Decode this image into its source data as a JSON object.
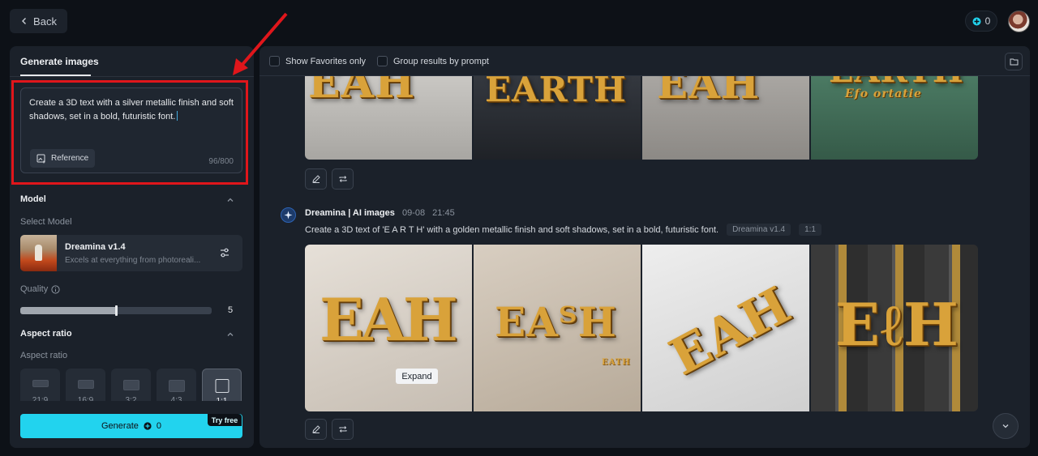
{
  "nav": {
    "back_label": "Back"
  },
  "account": {
    "credits": "0"
  },
  "sidebar": {
    "tab_label": "Generate images",
    "prompt": {
      "text": "Create a 3D text with a silver metallic finish and soft shadows, set in a bold, futuristic font.",
      "reference_label": "Reference",
      "char_count": "96/800"
    },
    "model_section": {
      "title": "Model",
      "select_label": "Select Model",
      "model_name": "Dreamina v1.4",
      "model_desc": "Excels at everything from photoreali..."
    },
    "quality": {
      "label": "Quality",
      "value": "5",
      "level_fraction": 0.5
    },
    "aspect_section": {
      "title": "Aspect ratio",
      "sub_label": "Aspect ratio",
      "options": [
        {
          "label": "21:9",
          "selected": false
        },
        {
          "label": "16:9",
          "selected": false
        },
        {
          "label": "3:2",
          "selected": false
        },
        {
          "label": "4:3",
          "selected": false
        },
        {
          "label": "1:1",
          "selected": true
        }
      ]
    },
    "generate": {
      "label": "Generate",
      "cost": "0",
      "badge": "Try free"
    }
  },
  "results": {
    "filters": {
      "favorites_label": "Show Favorites only",
      "group_label": "Group results by prompt"
    },
    "top_group": {
      "images": [
        {
          "text": "EAH",
          "bg": "#b8b6b2"
        },
        {
          "text": "EARTH",
          "bg": "#2a2d33"
        },
        {
          "text": "EAH",
          "bg": "#9b9894"
        },
        {
          "text": "EARTH",
          "caption": "Efo ortatie",
          "bg": "#3f6a56"
        }
      ]
    },
    "bottom_group": {
      "author": "Dreamina | AI images",
      "date": "09-08",
      "time": "21:45",
      "prompt": "Create a 3D text of 'E A R T H' with a golden metallic finish and soft shadows, set in a bold, futuristic font.",
      "model_tag": "Dreamina v1.4",
      "ratio_tag": "1:1",
      "expand_label": "Expand",
      "images": [
        {
          "text": "EAH",
          "bg": "#d8d2ca"
        },
        {
          "text": "EAᵀH",
          "caption": "EATH",
          "bg": "#cfc4b6"
        },
        {
          "text": "EAH",
          "bg": "#e4e4e4"
        },
        {
          "text": "EℓH",
          "bg": "#3a3a3a"
        }
      ]
    }
  },
  "colors": {
    "accent": "#22d3ee",
    "highlight": "#e0161b",
    "gold": "#d9a23a"
  }
}
